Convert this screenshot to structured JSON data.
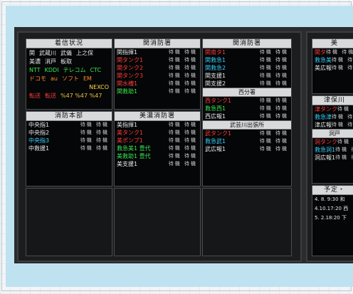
{
  "panels": {
    "chakushin": {
      "header": "着信状況",
      "lines": [
        [
          {
            "t": "関",
            "c": "white"
          },
          {
            "t": "武蔵川",
            "c": "white"
          },
          {
            "t": "武儀",
            "c": "white"
          },
          {
            "t": "上之保",
            "c": "white"
          }
        ],
        [
          {
            "t": "美濃",
            "c": "white"
          },
          {
            "t": "消戸",
            "c": "white"
          },
          {
            "t": "板取",
            "c": "white"
          }
        ],
        [
          {
            "t": "NTT",
            "c": "green"
          },
          {
            "t": "KDDI",
            "c": "green"
          },
          {
            "t": "テレコム",
            "c": "green"
          },
          {
            "t": "CTC",
            "c": "green"
          }
        ],
        [
          {
            "t": "ドコモ",
            "c": "orange"
          },
          {
            "t": "au",
            "c": "orange"
          },
          {
            "t": "ソフト",
            "c": "orange"
          },
          {
            "t": "EM",
            "c": "orange"
          }
        ],
        [
          {
            "t": "NEXCO",
            "c": "yellow"
          }
        ],
        [
          {
            "t": "転送",
            "c": "red"
          },
          {
            "t": "転送",
            "c": "red"
          },
          {
            "t": "%47 %47 %47",
            "c": "gold"
          }
        ]
      ]
    },
    "seki": {
      "header": "関消防署",
      "rows": [
        {
          "name": "関指揮1",
          "c": "white"
        },
        {
          "name": "関タンク1",
          "c": "red"
        },
        {
          "name": "関タンク2",
          "c": "red"
        },
        {
          "name": "関タンク3",
          "c": "red"
        },
        {
          "name": "関水槽1",
          "c": "red"
        },
        {
          "name": "関救助1",
          "c": "green"
        }
      ]
    },
    "kanto": {
      "header": "関消防署",
      "rows": [
        {
          "name": "関南タ1",
          "c": "red"
        },
        {
          "name": "関救急1",
          "c": "cyan"
        },
        {
          "name": "関救急2",
          "c": "cyan"
        },
        {
          "name": "関支援1",
          "c": "white"
        },
        {
          "name": "関支援2",
          "c": "white"
        }
      ],
      "sub_header": "西分署",
      "sub_rows": [
        {
          "name": "西タンク1",
          "c": "red"
        },
        {
          "name": "救急西1",
          "c": "green"
        },
        {
          "name": "西広報1",
          "c": "white"
        }
      ]
    },
    "honbu": {
      "header": "消防本部",
      "rows": [
        {
          "name": "中央指1",
          "c": "white"
        },
        {
          "name": "中央指2",
          "c": "white"
        },
        {
          "name": "中央指3",
          "c": "cyan"
        },
        {
          "name": "中救援1",
          "c": "white"
        }
      ]
    },
    "mino": {
      "header": "美濃消防署",
      "rows": [
        {
          "name": "美指揮1",
          "c": "white"
        },
        {
          "name": "美タンク1",
          "c": "red"
        },
        {
          "name": "美ポンプ1",
          "c": "red"
        },
        {
          "name": "救急美1 豊代",
          "c": "green"
        },
        {
          "name": "美救助1 豊代",
          "c": "green"
        },
        {
          "name": "美支援1",
          "c": "white"
        }
      ]
    },
    "mugegawa": {
      "header": "武芸川出張所",
      "rows": [
        {
          "name": "武タンク1",
          "c": "red"
        },
        {
          "name": "救急武1",
          "c": "cyan"
        },
        {
          "name": "武広報1",
          "c": "white"
        }
      ]
    },
    "right1": {
      "header": "美",
      "rows": [
        {
          "name": "関タ",
          "c": "red"
        },
        {
          "name": "救急美",
          "c": "cyan"
        },
        {
          "name": "美広報",
          "c": "white"
        }
      ]
    },
    "right2": {
      "header": "津保川",
      "rows": [
        {
          "name": "津タンク",
          "c": "red"
        },
        {
          "name": "救急津",
          "c": "cyan"
        },
        {
          "name": "津広報",
          "c": "white"
        }
      ],
      "sub_header": "洞戸",
      "sub_rows": [
        {
          "name": "洞タンク",
          "c": "red"
        },
        {
          "name": "救急洞1",
          "c": "cyan"
        },
        {
          "name": "洞広報1",
          "c": "white"
        }
      ]
    },
    "right3": {
      "header": "予定・",
      "lines": [
        "4. 8. 9:30 和",
        "4.10.17:20 西",
        "5. 2.18:20 下"
      ]
    }
  },
  "status_text": "待機",
  "colors": {
    "white": "#e8e8e8",
    "red": "#ff3a3a",
    "green": "#39e650",
    "cyan": "#34d0ff",
    "yellow": "#ffd84a",
    "orange": "#ff8c2a",
    "gold": "#e7c23a"
  }
}
